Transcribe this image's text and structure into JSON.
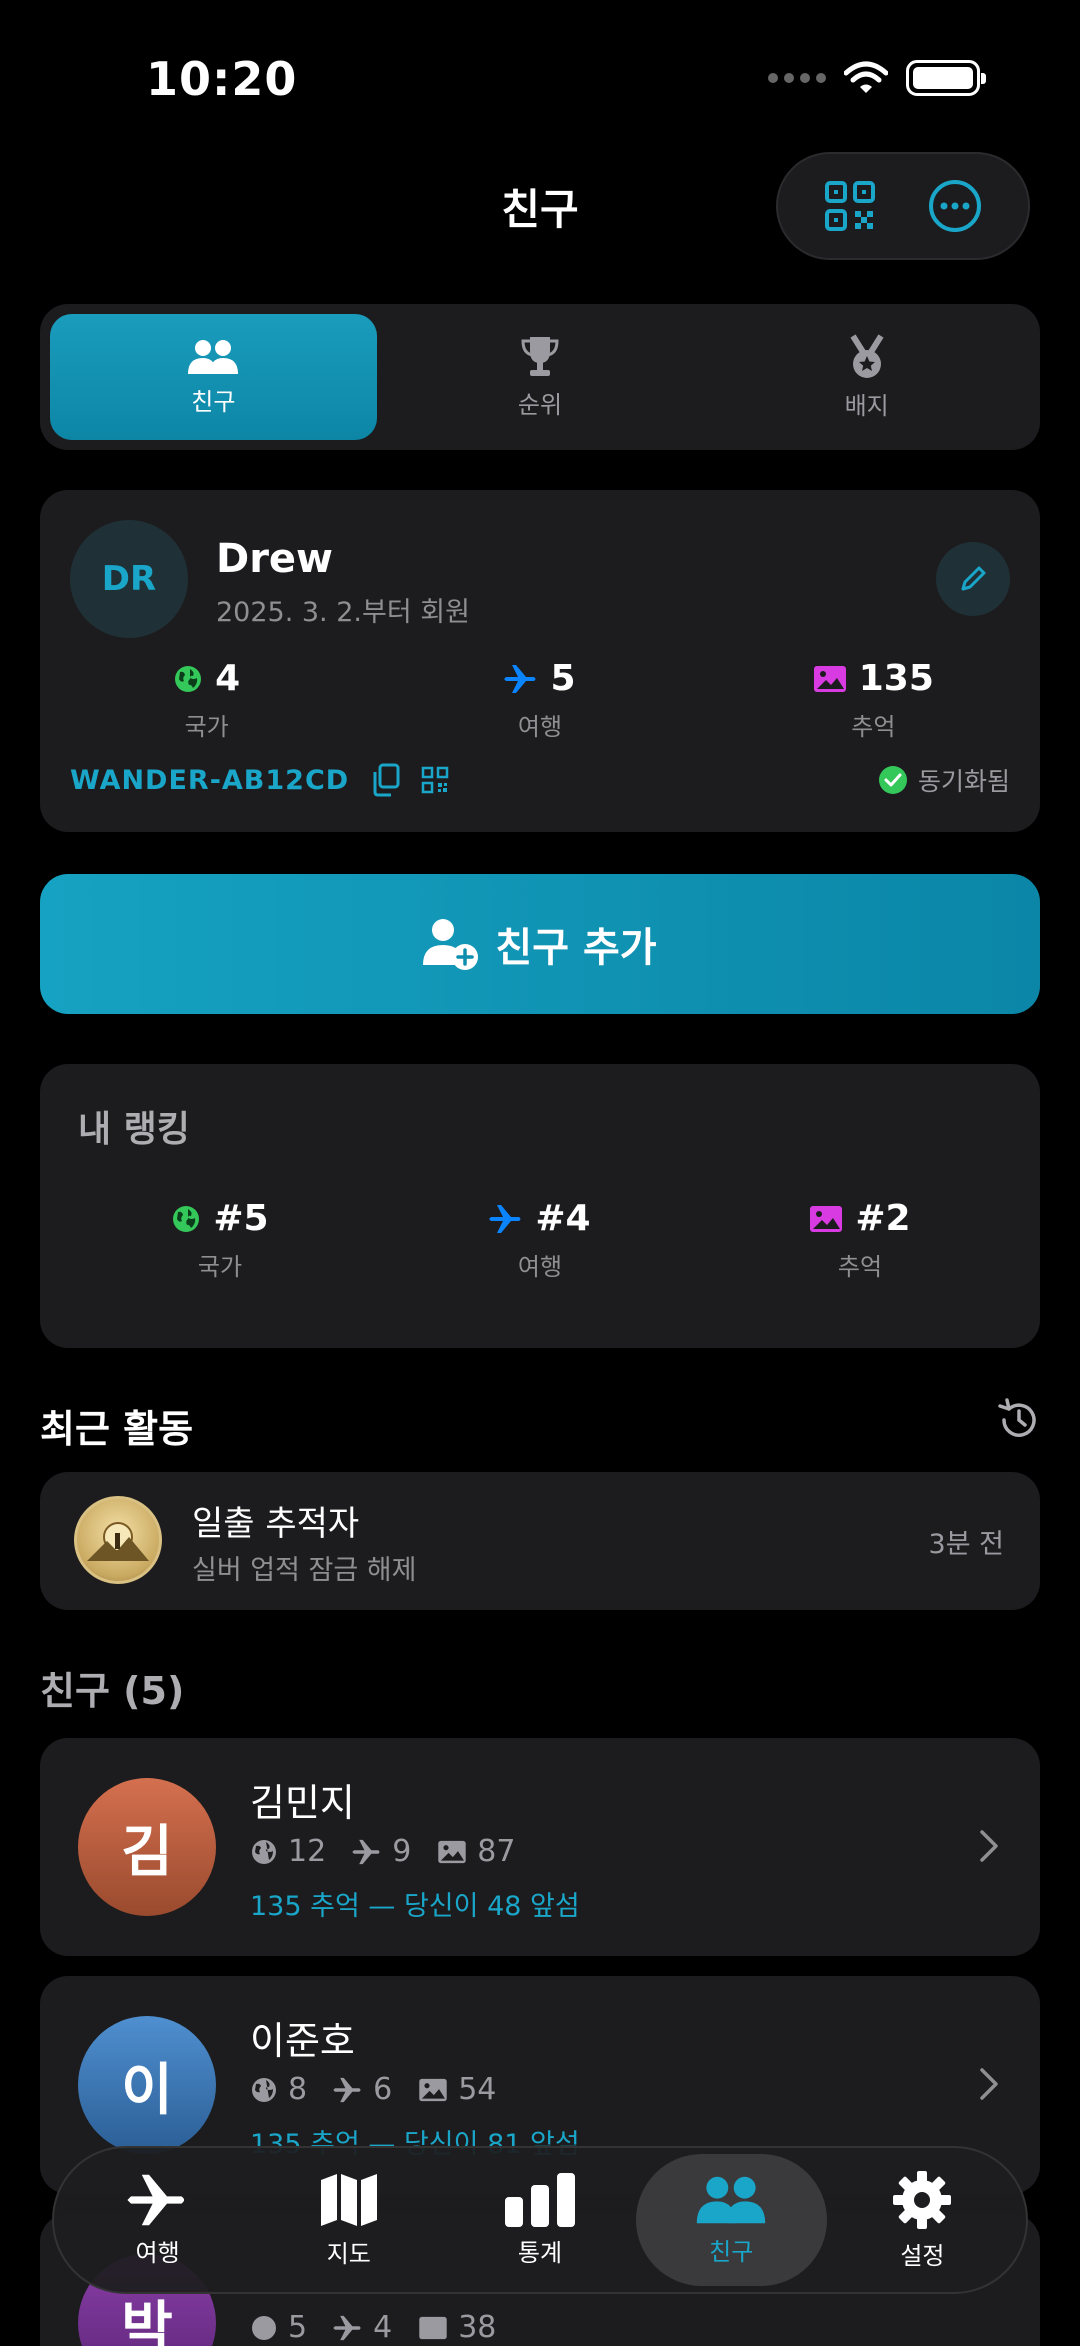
{
  "status": {
    "time": "10:20"
  },
  "header": {
    "title": "친구"
  },
  "segments": [
    {
      "label": "친구",
      "icon": "people-icon",
      "active": true
    },
    {
      "label": "순위",
      "icon": "trophy-icon",
      "active": false
    },
    {
      "label": "배지",
      "icon": "medal-icon",
      "active": false
    }
  ],
  "profile": {
    "initials": "DR",
    "name": "Drew",
    "since": "2025. 3. 2.부터 회원",
    "stats": [
      {
        "value": "4",
        "label": "국가",
        "icon": "globe-icon",
        "color": "#34c759"
      },
      {
        "value": "5",
        "label": "여행",
        "icon": "airplane-icon",
        "color": "#0a84ff"
      },
      {
        "value": "135",
        "label": "추억",
        "icon": "photo-icon",
        "color": "#d83be2"
      }
    ],
    "code": "WANDER-AB12CD",
    "sync_label": "동기화됨"
  },
  "add_friend": {
    "label": "친구 추가"
  },
  "ranking": {
    "title": "내 랭킹",
    "items": [
      {
        "value": "#5",
        "label": "국가"
      },
      {
        "value": "#4",
        "label": "여행"
      },
      {
        "value": "#2",
        "label": "추억"
      }
    ]
  },
  "recent": {
    "title": "최근 활동",
    "items": [
      {
        "title": "일출 추적자",
        "subtitle": "실버 업적 잠금 해제",
        "time": "3분 전"
      }
    ]
  },
  "friends": {
    "title": "친구 (5)",
    "items": [
      {
        "initial": "김",
        "name": "김민지",
        "countries": "12",
        "trips": "9",
        "memories": "87",
        "note": "135 추억 — 당신이 48 앞섬"
      },
      {
        "initial": "이",
        "name": "이준호",
        "countries": "8",
        "trips": "6",
        "memories": "54",
        "note": "135 추억 — 당신이 81 앞섬"
      },
      {
        "initial": "박",
        "name": "",
        "countries": "5",
        "trips": "4",
        "memories": "38",
        "note": ""
      }
    ]
  },
  "tabbar": [
    {
      "label": "여행",
      "icon": "airplane-icon",
      "active": false
    },
    {
      "label": "지도",
      "icon": "map-icon",
      "active": false
    },
    {
      "label": "통계",
      "icon": "bar-chart-icon",
      "active": false
    },
    {
      "label": "친구",
      "icon": "people-icon",
      "active": true
    },
    {
      "label": "설정",
      "icon": "gear-icon",
      "active": false
    }
  ],
  "colors": {
    "accent": "#1aa6c9",
    "card": "#1c1c1e",
    "green": "#34c759",
    "blue": "#0a84ff",
    "magenta": "#d83be2"
  }
}
